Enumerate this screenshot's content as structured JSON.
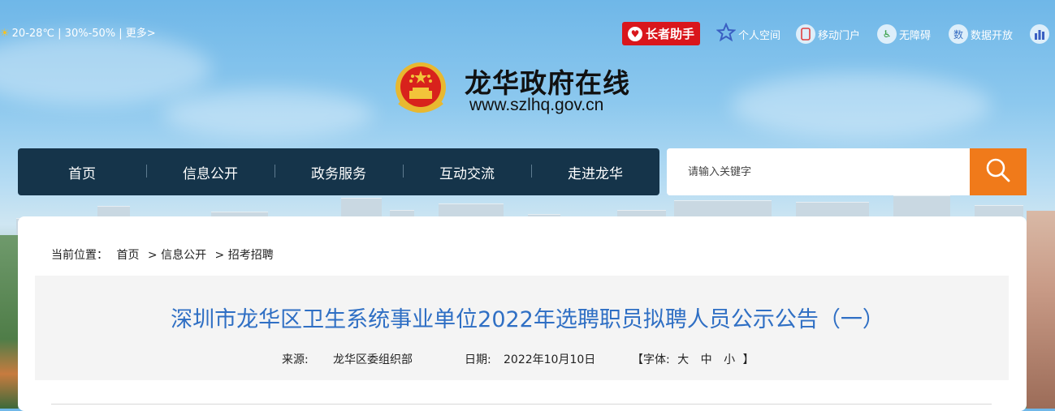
{
  "weather": {
    "text": "20-28℃ | 30%-50% | 更多>",
    "icon": "sun-icon"
  },
  "toolbar": {
    "elder_assistant": "长者助手",
    "personal_space": "个人空间",
    "mobile_portal": "移动门户",
    "accessibility": "无障碍",
    "data_open": "数据开放",
    "data_open_icon_text": "数"
  },
  "header": {
    "title": "龙华政府在线",
    "url": "www.szlhq.gov.cn"
  },
  "nav": {
    "items": [
      "首页",
      "信息公开",
      "政务服务",
      "互动交流",
      "走进龙华"
    ]
  },
  "search": {
    "placeholder": "请输入关键字"
  },
  "breadcrumb": {
    "label": "当前位置：",
    "items": [
      "首页",
      "> 信息公开",
      "> 招考招聘"
    ]
  },
  "article": {
    "title": "深圳市龙华区卫生系统事业单位2022年选聘职员拟聘人员公示公告（一）",
    "source_label": "来源:",
    "source": "龙华区委组织部",
    "date_label": "日期:",
    "date": "2022年10月10日",
    "font_label": "【字体:",
    "font_sizes": [
      "大",
      "中",
      "小"
    ],
    "font_close": "】"
  },
  "colors": {
    "nav_bg": "#15344a",
    "search_btn": "#f07a1a",
    "title": "#2f6fc4",
    "elder_btn": "#d9161c"
  }
}
